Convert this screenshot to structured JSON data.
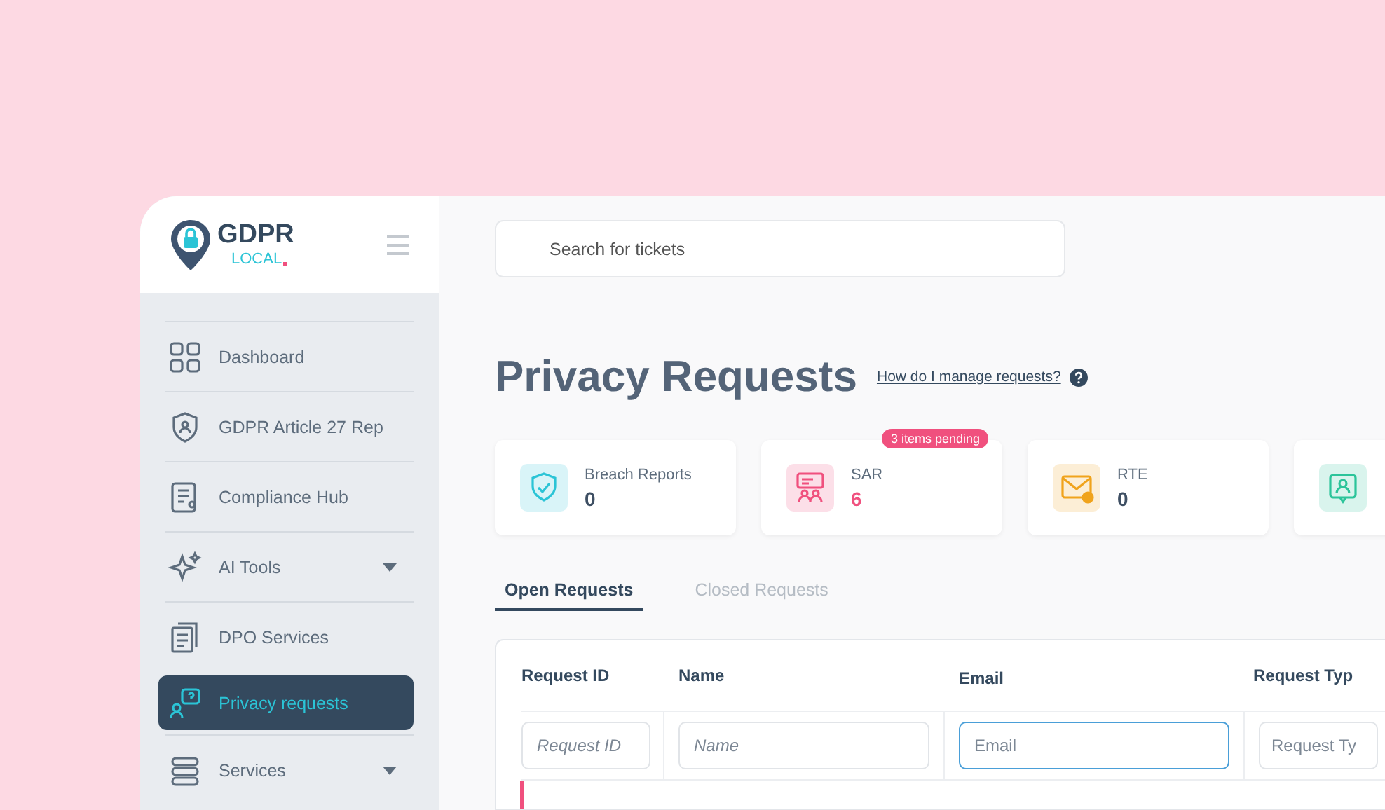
{
  "logo": {
    "name": "GDPR",
    "sub": "LOCAL"
  },
  "sidebar": {
    "items": [
      {
        "label": "Dashboard",
        "selected": false,
        "expandable": false
      },
      {
        "label": "GDPR Article 27 Rep",
        "selected": false,
        "expandable": false
      },
      {
        "label": "Compliance Hub",
        "selected": false,
        "expandable": false
      },
      {
        "label": "AI Tools",
        "selected": false,
        "expandable": true
      },
      {
        "label": "DPO Services",
        "selected": false,
        "expandable": false
      },
      {
        "label": "Privacy requests",
        "selected": true,
        "expandable": false
      },
      {
        "label": "Services",
        "selected": false,
        "expandable": true
      }
    ]
  },
  "search": {
    "placeholder": "Search for tickets"
  },
  "page_title": "Privacy Requests",
  "help_link": "How do I manage requests?",
  "stats": [
    {
      "label": "Breach Reports",
      "value": "0",
      "color": "#2bc4d6",
      "alert": false
    },
    {
      "label": "SAR",
      "value": "6",
      "color": "#f0507e",
      "alert": true,
      "badge": "3 items pending"
    },
    {
      "label": "RTE",
      "value": "0",
      "color": "#f0a31c",
      "alert": false
    },
    {
      "color": "#2cc49a"
    }
  ],
  "tabs": [
    {
      "label": "Open Requests",
      "selected": true
    },
    {
      "label": "Closed Requests",
      "selected": false
    }
  ],
  "table": {
    "columns": [
      {
        "label": "Request ID",
        "placeholder": "Request ID",
        "italic": true,
        "focused": false
      },
      {
        "label": "Name",
        "placeholder": "Name",
        "italic": true,
        "focused": false
      },
      {
        "label": "Email",
        "placeholder": "Email",
        "italic": false,
        "focused": true
      },
      {
        "label": "Request Typ",
        "placeholder": "Request Ty",
        "italic": false,
        "focused": false
      }
    ]
  }
}
